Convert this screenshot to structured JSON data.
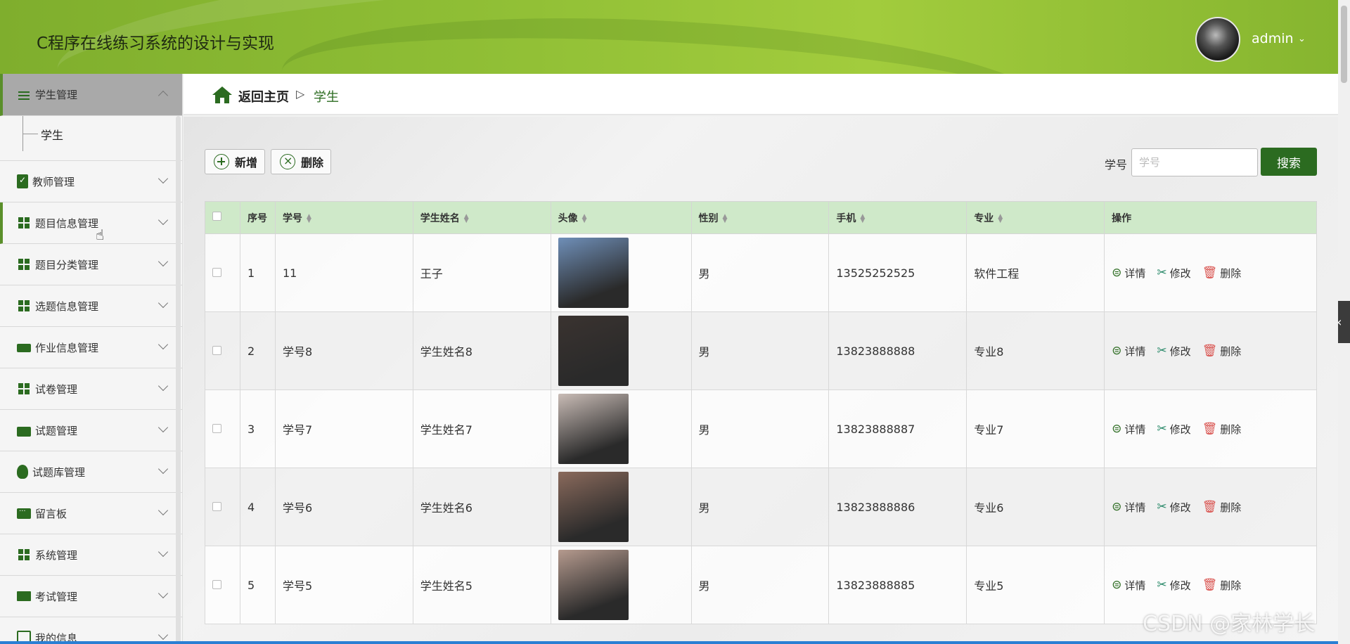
{
  "header": {
    "title": "C程序在线练习系统的设计与实现",
    "username": "admin"
  },
  "sidebar": {
    "items": [
      {
        "label": "学生管理",
        "icon": "sliders-icon",
        "active": true
      },
      {
        "label": "教师管理",
        "icon": "clipboard-check-icon"
      },
      {
        "label": "题目信息管理",
        "icon": "grid-icon"
      },
      {
        "label": "题目分类管理",
        "icon": "grid-icon"
      },
      {
        "label": "选题信息管理",
        "icon": "grid-icon"
      },
      {
        "label": "作业信息管理",
        "icon": "ticket-icon"
      },
      {
        "label": "试卷管理",
        "icon": "grid-icon"
      },
      {
        "label": "试题管理",
        "icon": "briefcase-icon"
      },
      {
        "label": "试题库管理",
        "icon": "bulb-icon"
      },
      {
        "label": "留言板",
        "icon": "chat-icon"
      },
      {
        "label": "系统管理",
        "icon": "grid-icon"
      },
      {
        "label": "考试管理",
        "icon": "monitor-icon"
      },
      {
        "label": "我的信息",
        "icon": "user-icon"
      }
    ],
    "submenu": {
      "label": "学生"
    }
  },
  "breadcrumb": {
    "home": "返回主页",
    "separator": "▷",
    "current": "学生"
  },
  "toolbar": {
    "add_label": "新增",
    "delete_label": "删除",
    "search_label": "学号",
    "search_placeholder": "学号",
    "search_button": "搜索"
  },
  "table": {
    "headers": [
      "序号",
      "学号",
      "学生姓名",
      "头像",
      "性别",
      "手机",
      "专业",
      "操作"
    ],
    "rows": [
      {
        "no": "1",
        "id": "11",
        "name": "王子",
        "gender": "男",
        "phone": "13525252525",
        "major": "软件工程",
        "photo_color": "#6f8fb8"
      },
      {
        "no": "2",
        "id": "学号8",
        "name": "学生姓名8",
        "gender": "男",
        "phone": "13823888888",
        "major": "专业8",
        "photo_color": "#3a3330"
      },
      {
        "no": "3",
        "id": "学号7",
        "name": "学生姓名7",
        "gender": "男",
        "phone": "13823888887",
        "major": "专业7",
        "photo_color": "#c9bcb6"
      },
      {
        "no": "4",
        "id": "学号6",
        "name": "学生姓名6",
        "gender": "男",
        "phone": "13823888886",
        "major": "专业6",
        "photo_color": "#8a6a5c"
      },
      {
        "no": "5",
        "id": "学号5",
        "name": "学生姓名5",
        "gender": "男",
        "phone": "13823888885",
        "major": "专业5",
        "photo_color": "#b59a8e"
      }
    ],
    "actions": {
      "detail": "详情",
      "edit": "修改",
      "delete": "删除"
    }
  },
  "watermark": "CSDN @家林学长",
  "colors": {
    "accent": "#2b6b20",
    "header": "#8fbe35",
    "table_header": "#cfe9c9"
  }
}
